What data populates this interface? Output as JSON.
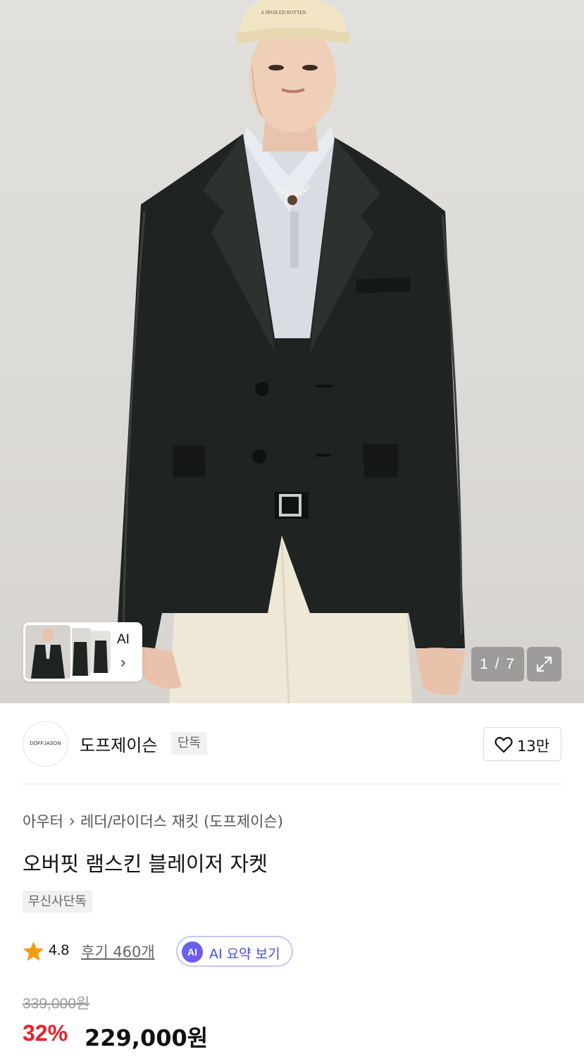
{
  "gallery": {
    "counter": "1 / 7",
    "thumb_ai_label": "AI",
    "thumb_chevron": "›",
    "cap_text": "A SPOILED ROTTEN",
    "icons": {
      "expand": "expand-icon",
      "chevron": "chevron-right-icon"
    }
  },
  "brand": {
    "logo_text": "DOFFJASON",
    "name": "도프제이슨",
    "tag": "단독",
    "like_count": "13만",
    "icons": {
      "like": "heart-icon"
    }
  },
  "product": {
    "category": [
      "아우터",
      "레더/라이더스 재킷 (도프제이슨)"
    ],
    "category_separator": "›",
    "title": "오버핏 램스킨 블레이저 자켓",
    "exclusive_tag": "무신사단독"
  },
  "rating": {
    "value": "4.8",
    "reviews_label": "후기 460개",
    "ai_badge": "AI",
    "ai_summary_label": "AI 요약 보기",
    "star_color": "#f39c12",
    "icons": {
      "star": "star-icon"
    }
  },
  "price": {
    "original": "339,000원",
    "discount": "32%",
    "sale": "229,000원",
    "discount_color": "#e8212a"
  }
}
